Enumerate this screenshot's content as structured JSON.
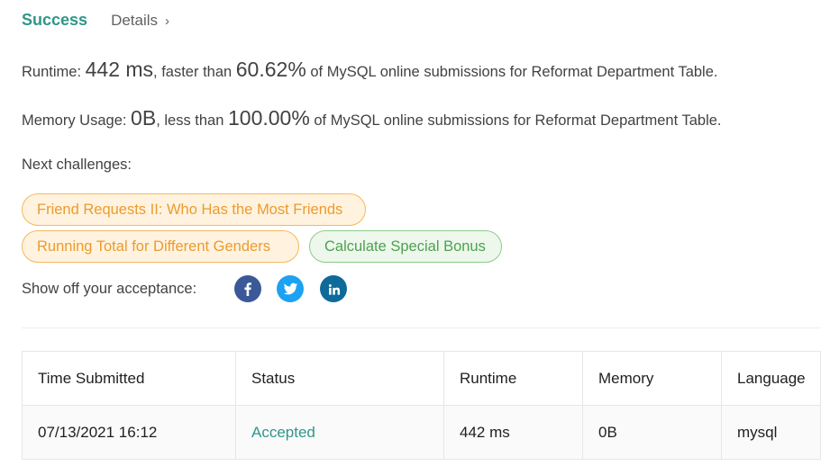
{
  "result": {
    "status": "Success",
    "details_label": "Details",
    "details_chevron": "›",
    "runtime_label": "Runtime: ",
    "runtime_value": "442 ms",
    "runtime_mid": ", faster than ",
    "runtime_percent": "60.62%",
    "runtime_tail": " of MySQL online submissions for Reformat Department Table.",
    "memory_label": "Memory Usage: ",
    "memory_value": "0B",
    "memory_mid": ", less than ",
    "memory_percent": "100.00%",
    "memory_tail": " of MySQL online submissions for Reformat Department Table."
  },
  "next_challenges": {
    "label": "Next challenges:",
    "items": [
      {
        "title": "Friend Requests II: Who Has the Most Friends",
        "difficulty": "medium",
        "color": "#ec9b2e"
      },
      {
        "title": "Running Total for Different Genders",
        "difficulty": "medium",
        "color": "#ec9b2e"
      },
      {
        "title": "Calculate Special Bonus",
        "difficulty": "easy",
        "color": "#4ea150"
      }
    ]
  },
  "share": {
    "label": "Show off your acceptance:",
    "icons": [
      "facebook-icon",
      "twitter-icon",
      "linkedin-icon"
    ]
  },
  "submissions": {
    "headers": [
      "Time Submitted",
      "Status",
      "Runtime",
      "Memory",
      "Language"
    ],
    "rows": [
      {
        "time": "07/13/2021 16:12",
        "status": "Accepted",
        "runtime": "442 ms",
        "memory": "0B",
        "language": "mysql"
      }
    ]
  },
  "colors": {
    "accent": "#2f9688",
    "medium": "#ec9b2e",
    "easy": "#4ea150"
  }
}
